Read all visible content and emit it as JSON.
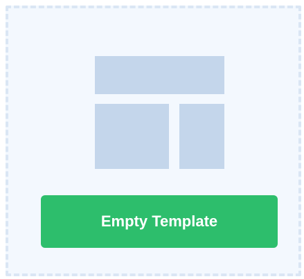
{
  "template_card": {
    "icon": "layout-template-icon",
    "button_label": "Empty Template",
    "colors": {
      "card_background": "#f3f8fe",
      "card_border": "#dae6f4",
      "layout_blocks": "#c4d6eb",
      "button_background": "#2dbe6c",
      "button_text": "#ffffff"
    }
  }
}
